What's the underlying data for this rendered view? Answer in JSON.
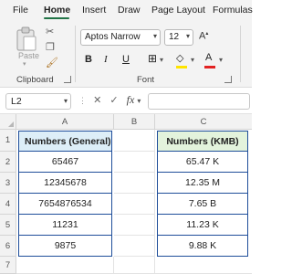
{
  "ribbon_tabs": [
    "File",
    "Home",
    "Insert",
    "Draw",
    "Page Layout",
    "Formulas"
  ],
  "active_tab": "Home",
  "clipboard": {
    "paste_label": "Paste",
    "group_label": "Clipboard"
  },
  "font": {
    "font_name": "Aptos Narrow",
    "font_size": "12",
    "group_label": "Font",
    "bold": "B",
    "italic": "I",
    "underline": "U",
    "font_color_glyph": "A"
  },
  "formula_bar": {
    "name_box": "L2",
    "fx": "fx",
    "cancel": "✕",
    "enter": "✓",
    "formula": ""
  },
  "columns": [
    "A",
    "B",
    "C"
  ],
  "rows": [
    "1",
    "2",
    "3",
    "4",
    "5",
    "6",
    "7"
  ],
  "table_general": {
    "header": "Numbers (General)",
    "values": [
      "65467",
      "12345678",
      "7654876534",
      "11231",
      "9875"
    ]
  },
  "table_kmb": {
    "header": "Numbers (KMB)",
    "values": [
      "65.47 K",
      "12.35 M",
      "7.65 B",
      "11.23 K",
      "9.88 K"
    ]
  },
  "colors": {
    "table_border": "#1f4e9a",
    "header_blue": "#ddeef8",
    "header_green": "#e3f3dc",
    "accent": "#217346",
    "font_color": "#e22222",
    "fill_color": "#ffe400"
  }
}
